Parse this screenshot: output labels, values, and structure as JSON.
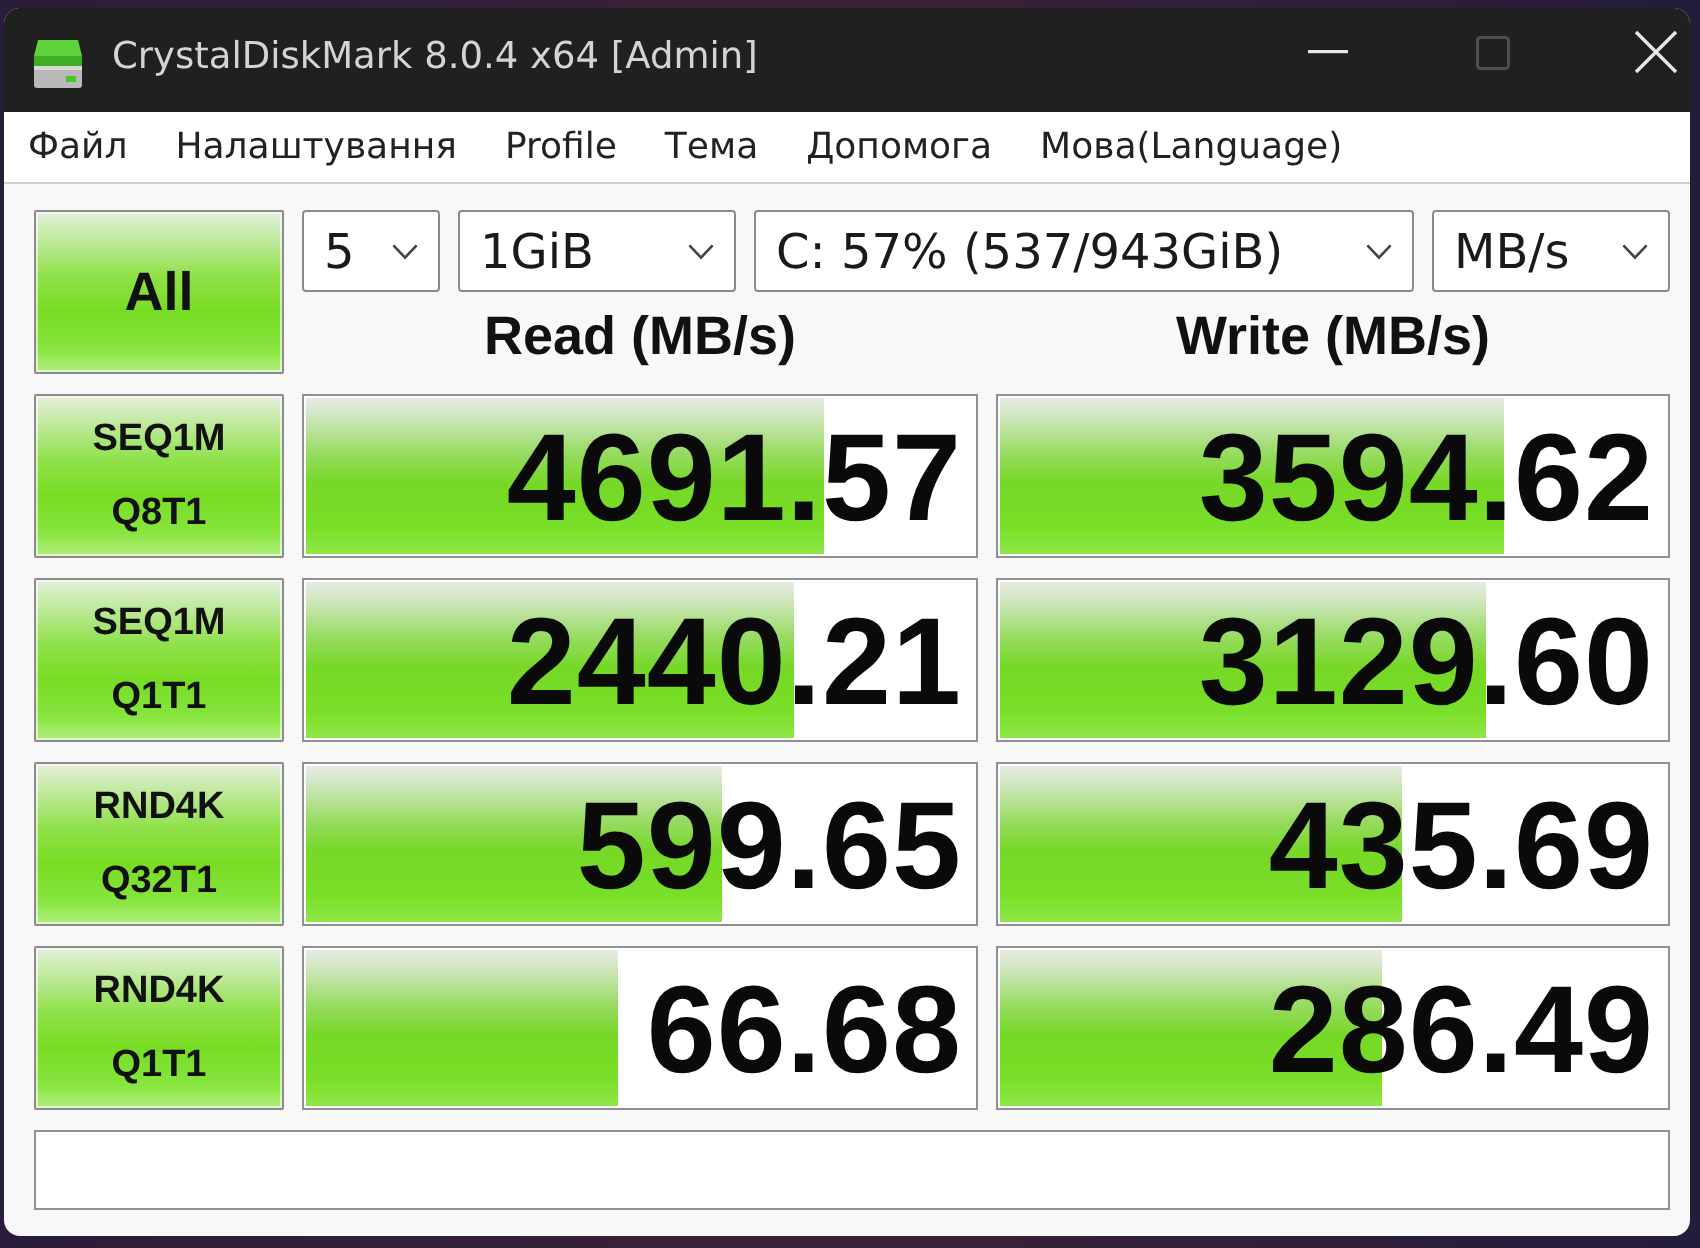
{
  "window": {
    "title": "CrystalDiskMark 8.0.4 x64 [Admin]",
    "buttons": [
      {
        "kind": "minimize",
        "disabled": false
      },
      {
        "kind": "maximize",
        "disabled": true
      },
      {
        "kind": "close",
        "disabled": false
      }
    ]
  },
  "menu": [
    "Файл",
    "Налаштування",
    "Profile",
    "Тема",
    "Допомога",
    "Мова(Language)"
  ],
  "all_button": "All",
  "selects": [
    {
      "value": "5"
    },
    {
      "value": "1GiB"
    },
    {
      "value": "C: 57% (537/943GiB)"
    },
    {
      "value": "MB/s"
    }
  ],
  "headers": {
    "read": "Read (MB/s)",
    "write": "Write (MB/s)"
  },
  "tests": [
    {
      "name": "SEQ1M",
      "params": "Q8T1",
      "read": {
        "value": "4691.57",
        "level": 0.775
      },
      "write": {
        "value": "3594.62",
        "level": 0.757
      }
    },
    {
      "name": "SEQ1M",
      "params": "Q1T1",
      "read": {
        "value": "2440.21",
        "level": 0.73
      },
      "write": {
        "value": "3129.60",
        "level": 0.73
      }
    },
    {
      "name": "RND4K",
      "params": "Q32T1",
      "read": {
        "value": "599.65",
        "level": 0.624
      },
      "write": {
        "value": "435.69",
        "level": 0.604
      }
    },
    {
      "name": "RND4K",
      "params": "Q1T1",
      "read": {
        "value": "66.68",
        "level": 0.468
      },
      "write": {
        "value": "286.49",
        "level": 0.574
      }
    }
  ]
}
